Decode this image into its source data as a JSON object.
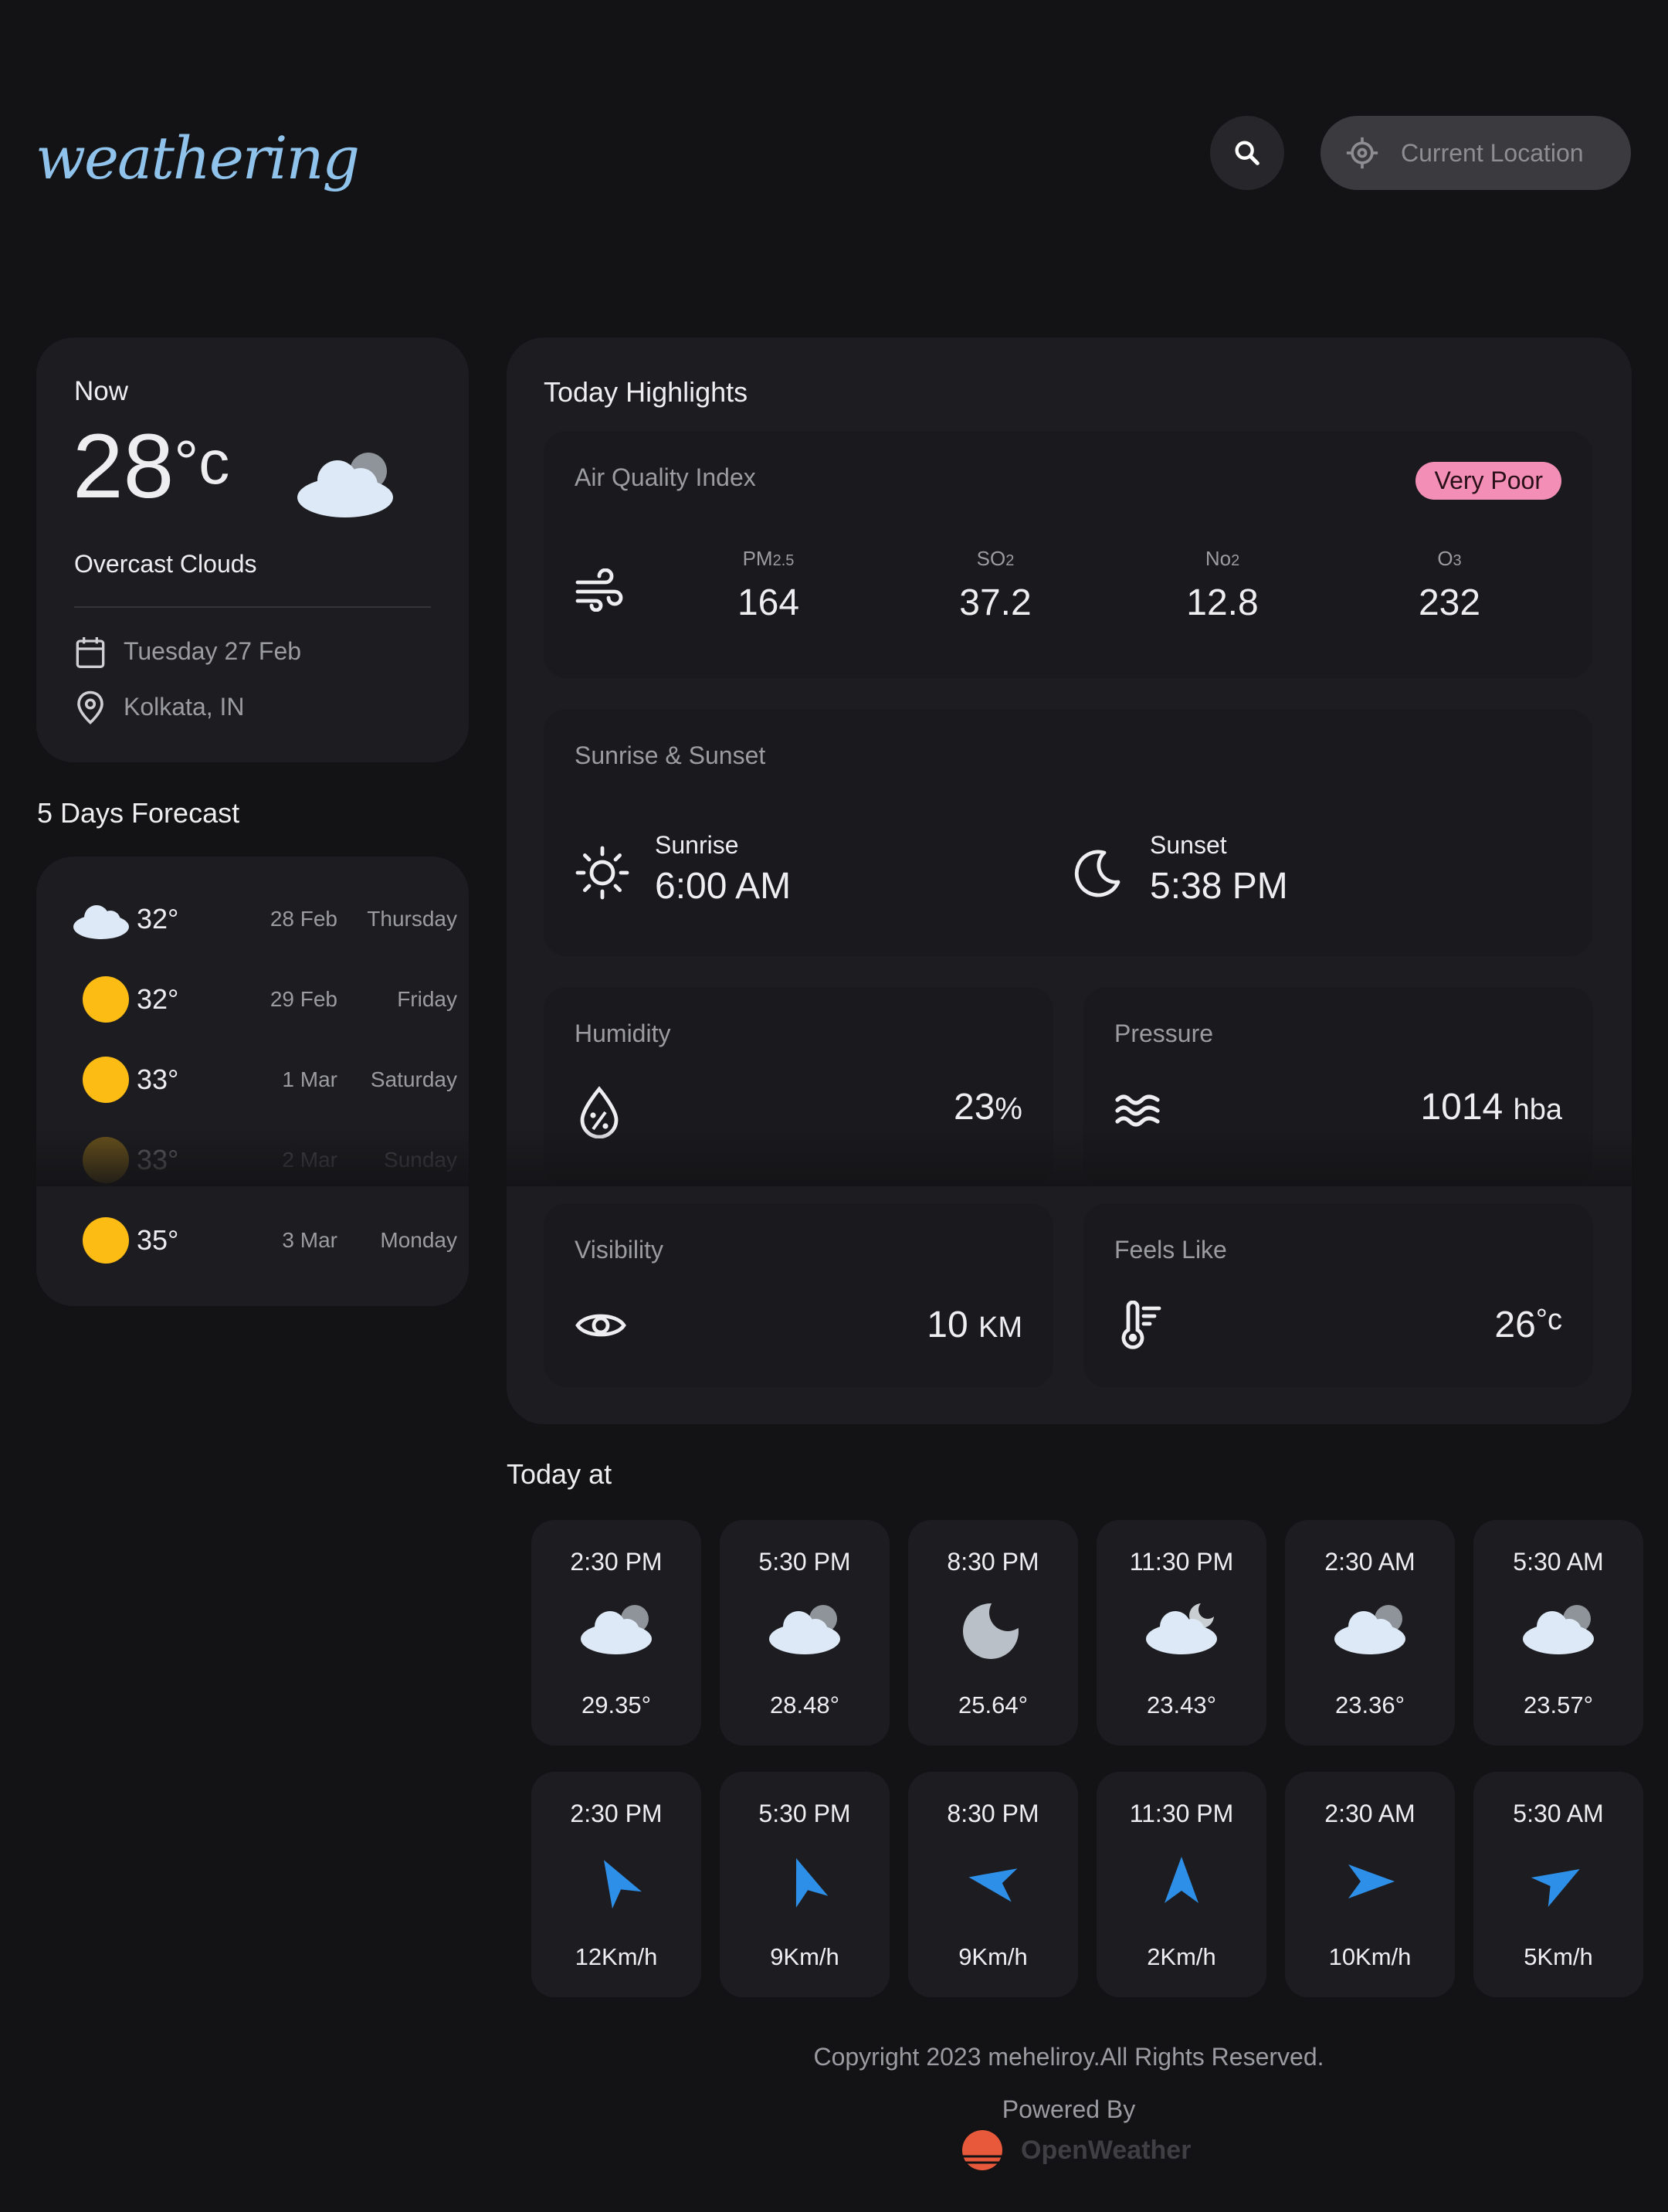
{
  "header": {
    "logo": "weathering",
    "location_button_label": "Current Location"
  },
  "now": {
    "label": "Now",
    "temp": "28",
    "unit": "°c",
    "description": "Overcast Clouds",
    "date": "Tuesday 27 Feb",
    "location": "Kolkata, IN"
  },
  "forecast": {
    "title": "5 Days Forecast",
    "items": [
      {
        "icon": "cloud-icon",
        "temp": "32°",
        "date": "28 Feb",
        "day": "Thursday"
      },
      {
        "icon": "sun-icon",
        "temp": "32°",
        "date": "29 Feb",
        "day": "Friday"
      },
      {
        "icon": "sun-icon",
        "temp": "33°",
        "date": "1 Mar",
        "day": "Saturday"
      },
      {
        "icon": "sun-icon",
        "temp": "33°",
        "date": "2 Mar",
        "day": "Sunday"
      },
      {
        "icon": "sun-icon",
        "temp": "35°",
        "date": "3 Mar",
        "day": "Monday"
      }
    ]
  },
  "highlights": {
    "title": "Today Highlights",
    "aqi": {
      "title": "Air Quality Index",
      "badge": "Very Poor",
      "badge_color": "#f38fb6",
      "pm25_label": "PM",
      "pm25_sub": "2.5",
      "pm25_value": "164",
      "so2_label": "SO",
      "so2_sub": "2",
      "so2_value": "37.2",
      "no2_label": "No",
      "no2_sub": "2",
      "no2_value": "12.8",
      "o3_label": "O",
      "o3_sub": "3",
      "o3_value": "232"
    },
    "sun": {
      "title": "Sunrise & Sunset",
      "sunrise_label": "Sunrise",
      "sunrise_value": "6:00 AM",
      "sunset_label": "Sunset",
      "sunset_value": "5:38 PM"
    },
    "humidity": {
      "title": "Humidity",
      "value": "23",
      "unit": "%"
    },
    "pressure": {
      "title": "Pressure",
      "value": "1014",
      "unit": "hba"
    },
    "visibility": {
      "title": "Visibility",
      "value": "10",
      "unit": "KM"
    },
    "feels_like": {
      "title": "Feels Like",
      "value": "26",
      "unit": "°c"
    }
  },
  "today_at": {
    "title": "Today at",
    "weather": [
      {
        "time": "2:30 PM",
        "icon": "cloud-icon",
        "temp": "29.35°"
      },
      {
        "time": "5:30 PM",
        "icon": "cloud-icon",
        "temp": "28.48°"
      },
      {
        "time": "8:30 PM",
        "icon": "moon-icon",
        "temp": "25.64°"
      },
      {
        "time": "11:30 PM",
        "icon": "cloud-moon-icon",
        "temp": "23.43°"
      },
      {
        "time": "2:30 AM",
        "icon": "cloud-icon",
        "temp": "23.36°"
      },
      {
        "time": "5:30 AM",
        "icon": "cloud-icon",
        "temp": "23.57°"
      }
    ],
    "wind": [
      {
        "time": "2:30 PM",
        "speed": "12Km/h"
      },
      {
        "time": "5:30 PM",
        "speed": "9Km/h"
      },
      {
        "time": "8:30 PM",
        "speed": "9Km/h"
      },
      {
        "time": "11:30 PM",
        "speed": "2Km/h"
      },
      {
        "time": "2:30 AM",
        "speed": "10Km/h"
      },
      {
        "time": "5:30 AM",
        "speed": "5Km/h"
      }
    ]
  },
  "footer": {
    "copyright": "Copyright 2023 meheliroy.All Rights Reserved.",
    "powered_by": "Powered By",
    "brand": "OpenWeather"
  }
}
